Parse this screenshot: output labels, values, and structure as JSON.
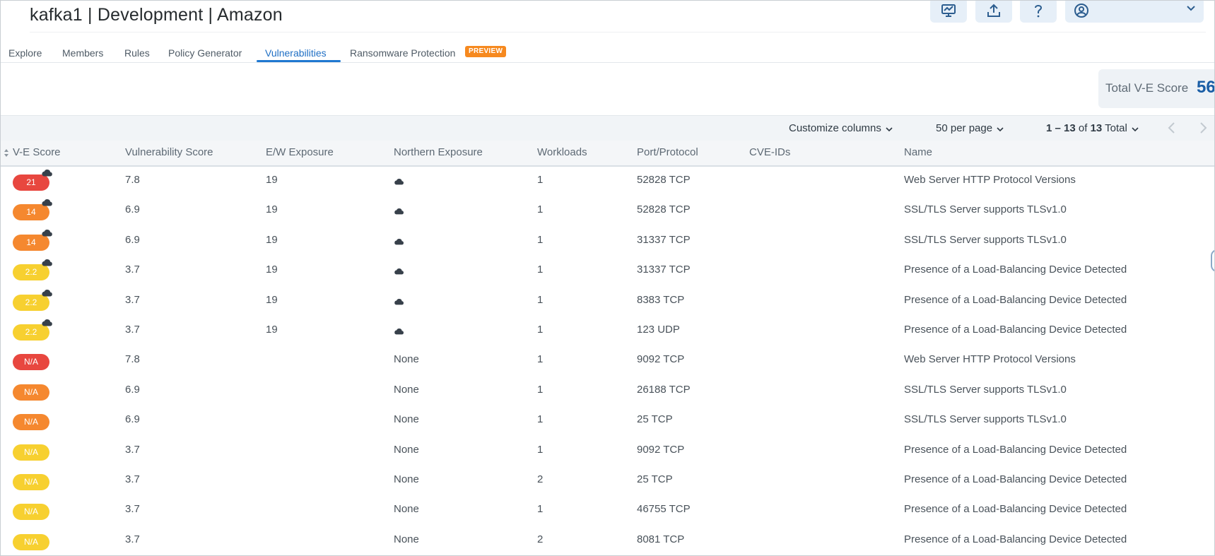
{
  "header": {
    "title": "kafka1 | Development | Amazon",
    "actions": [
      "monitor-chart-icon",
      "upload-icon",
      "help-icon",
      "user-icon"
    ]
  },
  "tabs": [
    {
      "label": "Explore"
    },
    {
      "label": "Members"
    },
    {
      "label": "Rules"
    },
    {
      "label": "Policy Generator"
    },
    {
      "label": "Vulnerabilities"
    },
    {
      "label": "Ransomware Protection",
      "badge": "PREVIEW"
    }
  ],
  "summary": {
    "label": "Total V-E Score",
    "value": "56"
  },
  "toolbar": {
    "customize": "Customize columns",
    "per_page": "50 per page",
    "range_prefix": "1 – 13",
    "range_of": "of",
    "range_total": "13",
    "range_suffix": "Total"
  },
  "table": {
    "columns": [
      "V-E Score",
      "Vulnerability Score",
      "E/W Exposure",
      "Northern Exposure",
      "Workloads",
      "Port/Protocol",
      "CVE-IDs",
      "Name"
    ],
    "rows": [
      {
        "ve": "21",
        "ve_level": "red",
        "internet": true,
        "vuln": "7.8",
        "ew": "19",
        "north": "",
        "north_icon": true,
        "workloads": "1",
        "port": "52828 TCP",
        "cve": "",
        "name": "Web Server HTTP Protocol Versions"
      },
      {
        "ve": "14",
        "ve_level": "orange",
        "internet": true,
        "vuln": "6.9",
        "ew": "19",
        "north": "",
        "north_icon": true,
        "workloads": "1",
        "port": "52828 TCP",
        "cve": "",
        "name": "SSL/TLS Server supports TLSv1.0"
      },
      {
        "ve": "14",
        "ve_level": "orange",
        "internet": true,
        "vuln": "6.9",
        "ew": "19",
        "north": "",
        "north_icon": true,
        "workloads": "1",
        "port": "31337 TCP",
        "cve": "",
        "name": "SSL/TLS Server supports TLSv1.0"
      },
      {
        "ve": "2.2",
        "ve_level": "yellow",
        "internet": true,
        "vuln": "3.7",
        "ew": "19",
        "north": "",
        "north_icon": true,
        "workloads": "1",
        "port": "31337 TCP",
        "cve": "",
        "name": "Presence of a Load-Balancing Device Detected"
      },
      {
        "ve": "2.2",
        "ve_level": "yellow",
        "internet": true,
        "vuln": "3.7",
        "ew": "19",
        "north": "",
        "north_icon": true,
        "workloads": "1",
        "port": "8383 TCP",
        "cve": "",
        "name": "Presence of a Load-Balancing Device Detected"
      },
      {
        "ve": "2.2",
        "ve_level": "yellow",
        "internet": true,
        "vuln": "3.7",
        "ew": "19",
        "north": "",
        "north_icon": true,
        "workloads": "1",
        "port": "123 UDP",
        "cve": "",
        "name": "Presence of a Load-Balancing Device Detected"
      },
      {
        "ve": "N/A",
        "ve_level": "red",
        "internet": false,
        "vuln": "7.8",
        "ew": "",
        "north": "None",
        "north_icon": false,
        "workloads": "1",
        "port": "9092 TCP",
        "cve": "",
        "name": "Web Server HTTP Protocol Versions"
      },
      {
        "ve": "N/A",
        "ve_level": "orange",
        "internet": false,
        "vuln": "6.9",
        "ew": "",
        "north": "None",
        "north_icon": false,
        "workloads": "1",
        "port": "26188 TCP",
        "cve": "",
        "name": "SSL/TLS Server supports TLSv1.0"
      },
      {
        "ve": "N/A",
        "ve_level": "orange",
        "internet": false,
        "vuln": "6.9",
        "ew": "",
        "north": "None",
        "north_icon": false,
        "workloads": "1",
        "port": "25 TCP",
        "cve": "",
        "name": "SSL/TLS Server supports TLSv1.0"
      },
      {
        "ve": "N/A",
        "ve_level": "yellow",
        "internet": false,
        "vuln": "3.7",
        "ew": "",
        "north": "None",
        "north_icon": false,
        "workloads": "1",
        "port": "9092 TCP",
        "cve": "",
        "name": "Presence of a Load-Balancing Device Detected"
      },
      {
        "ve": "N/A",
        "ve_level": "yellow",
        "internet": false,
        "vuln": "3.7",
        "ew": "",
        "north": "None",
        "north_icon": false,
        "workloads": "2",
        "port": "25 TCP",
        "cve": "",
        "name": "Presence of a Load-Balancing Device Detected"
      },
      {
        "ve": "N/A",
        "ve_level": "yellow",
        "internet": false,
        "vuln": "3.7",
        "ew": "",
        "north": "None",
        "north_icon": false,
        "workloads": "1",
        "port": "46755 TCP",
        "cve": "",
        "name": "Presence of a Load-Balancing Device Detected"
      },
      {
        "ve": "N/A",
        "ve_level": "yellow",
        "internet": false,
        "vuln": "3.7",
        "ew": "",
        "north": "None",
        "north_icon": false,
        "workloads": "2",
        "port": "8081 TCP",
        "cve": "",
        "name": "Presence of a Load-Balancing Device Detected"
      }
    ]
  },
  "colors": {
    "accent": "#1f78d1",
    "red": "#e8473f",
    "orange": "#f5882f",
    "yellow": "#f7d030",
    "badge": "#f6891f"
  }
}
